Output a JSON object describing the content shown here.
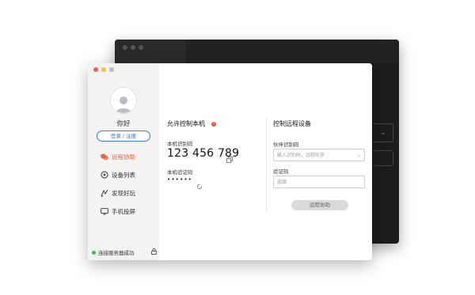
{
  "sidebar": {
    "greeting": "你好",
    "login_label": "登录 / 注册",
    "items": [
      {
        "label": "远程协助",
        "icon": "remote-assist-icon",
        "active": true
      },
      {
        "label": "设备列表",
        "icon": "device-list-icon",
        "active": false
      },
      {
        "label": "发现好玩",
        "icon": "discover-icon",
        "active": false
      },
      {
        "label": "手机投屏",
        "icon": "screen-cast-icon",
        "active": false
      }
    ],
    "status_text": "连接服务器成功"
  },
  "allow_control": {
    "title": "允许控制本机",
    "id_label": "本机识别码",
    "id_value": "123 456 789",
    "code_label": "本机验证码",
    "code_value": "••••••"
  },
  "remote_control": {
    "title": "控制远程设备",
    "partner_label": "伙伴识别码",
    "partner_placeholder": "输入识别码，远程伙伴",
    "code_label": "验证码",
    "code_placeholder": "选填",
    "connect_label": "远程协助"
  },
  "colors": {
    "accent": "#f0643b",
    "link": "#3a7bd5",
    "status_ok": "#3ec23e"
  }
}
